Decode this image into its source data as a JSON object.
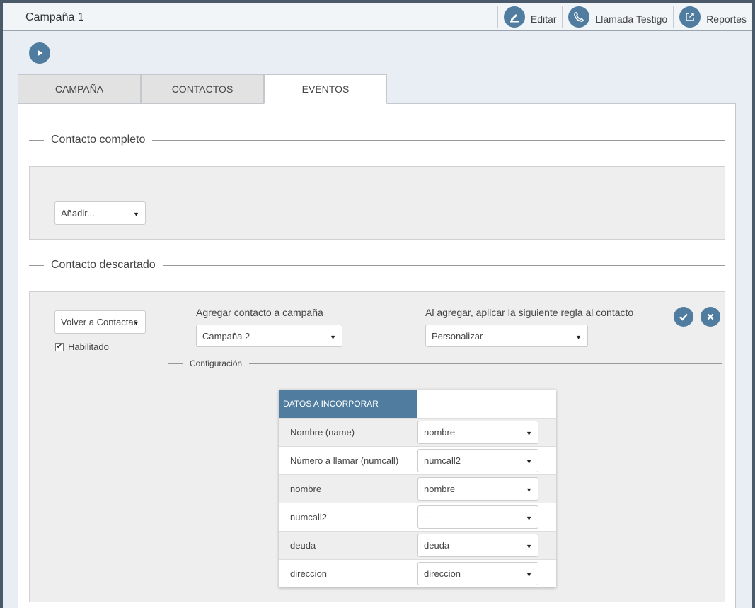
{
  "title": "Campaña 1",
  "toolbar": {
    "edit": "Editar",
    "witness_call": "Llamada Testigo",
    "reports": "Reportes"
  },
  "tabs": [
    "CAMPAÑA",
    "CONTACTOS",
    "EVENTOS"
  ],
  "active_tab": "EVENTOS",
  "sections": {
    "complete": {
      "legend": "Contacto completo",
      "add_select": "Añadir..."
    },
    "discarded": {
      "legend": "Contacto descartado",
      "action_select": "Volver a Contactar",
      "enabled_label": "Habilitado",
      "enabled_checked": true,
      "campaign_label": "Agregar contacto a campaña",
      "campaign_value": "Campaña 2",
      "rule_label": "Al agregar, aplicar la siguiente regla al contacto",
      "rule_value": "Personalizar",
      "config_legend": "Configuración",
      "table": {
        "header": "DATOS A INCORPORAR",
        "rows": [
          {
            "label": "Nombre (name)",
            "value": "nombre"
          },
          {
            "label": "Número a llamar (numcall)",
            "value": "numcall2"
          },
          {
            "label": "nombre",
            "value": "nombre"
          },
          {
            "label": "numcall2",
            "value": "--"
          },
          {
            "label": "deuda",
            "value": "deuda"
          },
          {
            "label": "direccion",
            "value": "direccion"
          }
        ]
      }
    }
  },
  "colors": {
    "accent": "#4f7c9f",
    "background": "#e8eef4",
    "panel_gray": "#eeeeee"
  },
  "icons": {
    "edit": "pencil-icon",
    "witness_call": "phone-icon",
    "reports": "external-link-icon",
    "play": "play-icon",
    "confirm": "check-icon",
    "cancel": "close-icon",
    "dropdown": "caret-down-icon"
  }
}
